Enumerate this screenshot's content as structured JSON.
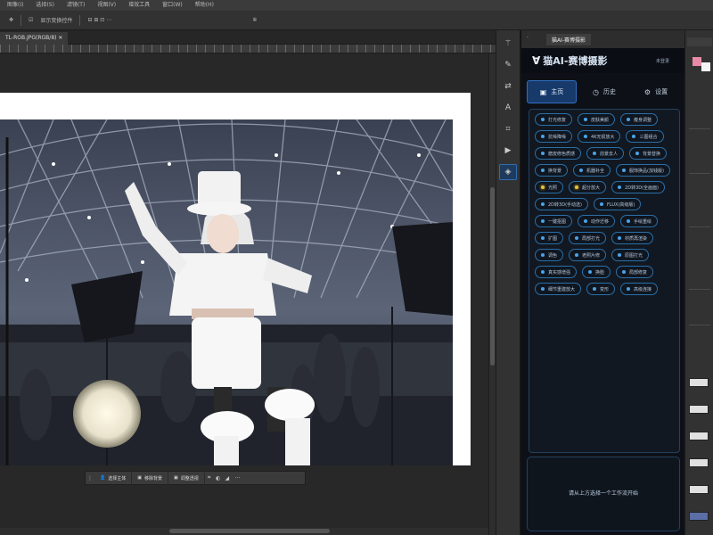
{
  "menubar": [
    "图像(I)",
    "选择(S)",
    "滤镜(T)",
    "视图(V)",
    "增效工具",
    "窗口(W)",
    "帮助(H)"
  ],
  "optionsbar": {
    "show_transform": "显示变换控件"
  },
  "document": {
    "tab_label": "TL-ROB.JPG(RGB/8)"
  },
  "context_bar": {
    "btn1": "选择主体",
    "btn2": "移除背景",
    "btn3": "调整透视",
    "more": "···"
  },
  "tools": [
    "wand-icon",
    "brush-icon",
    "transform-icon",
    "text-icon",
    "crop-icon",
    "play-icon",
    "plugin-icon"
  ],
  "plugin": {
    "tab_small": "·",
    "tab_name": "猫AI-赛博摄影",
    "brand_logo": "Ɐ",
    "brand_title": "猫AI-赛博摄影",
    "brand_sub": "未登录",
    "tabs": [
      {
        "label": "主页",
        "icon": "▣"
      },
      {
        "label": "历史",
        "icon": "◷"
      },
      {
        "label": "设置",
        "icon": "⚙"
      }
    ],
    "features": [
      {
        "label": "打光修复",
        "star": false
      },
      {
        "label": "皮肤美颜",
        "star": false
      },
      {
        "label": "瘦身调整",
        "star": false
      },
      {
        "label": "抗噪降噪",
        "star": false
      },
      {
        "label": "4K无损放大",
        "star": false
      },
      {
        "label": "三图组合",
        "star": false
      },
      {
        "label": "磨皮修色质感",
        "star": false
      },
      {
        "label": "前景去人",
        "star": false
      },
      {
        "label": "背景替换",
        "star": false
      },
      {
        "label": "换背景",
        "star": false
      },
      {
        "label": "机器补全",
        "star": false
      },
      {
        "label": "服饰换品(加钱版)",
        "star": false
      },
      {
        "label": "光照",
        "star": true
      },
      {
        "label": "超分放大",
        "star": true
      },
      {
        "label": "2D转3D(全画面)",
        "star": false
      },
      {
        "label": "2D转3D(手动选)",
        "star": false
      },
      {
        "label": "FLUX(高级版)",
        "star": false
      },
      {
        "label": "一键抠图",
        "star": false
      },
      {
        "label": "动作迁移",
        "star": false
      },
      {
        "label": "手绘重绘",
        "star": false
      },
      {
        "label": "扩图",
        "star": false
      },
      {
        "label": "局部打光",
        "star": false
      },
      {
        "label": "材质再渲染",
        "star": false
      },
      {
        "label": "调色",
        "star": false
      },
      {
        "label": "老照片修",
        "star": false
      },
      {
        "label": "原图打光",
        "star": false
      },
      {
        "label": "真实感增强",
        "star": false
      },
      {
        "label": "换脸",
        "star": false
      },
      {
        "label": "局部修复",
        "star": false
      },
      {
        "label": "细节重建放大",
        "star": false
      },
      {
        "label": "变形",
        "star": false
      },
      {
        "label": "高级连接",
        "star": false
      }
    ],
    "hint": "请从上方选择一个工作流开始"
  },
  "colors": {
    "accent": "#2f6fc4",
    "plugin_bg": "#0d1117",
    "star": "#e8c13a"
  }
}
